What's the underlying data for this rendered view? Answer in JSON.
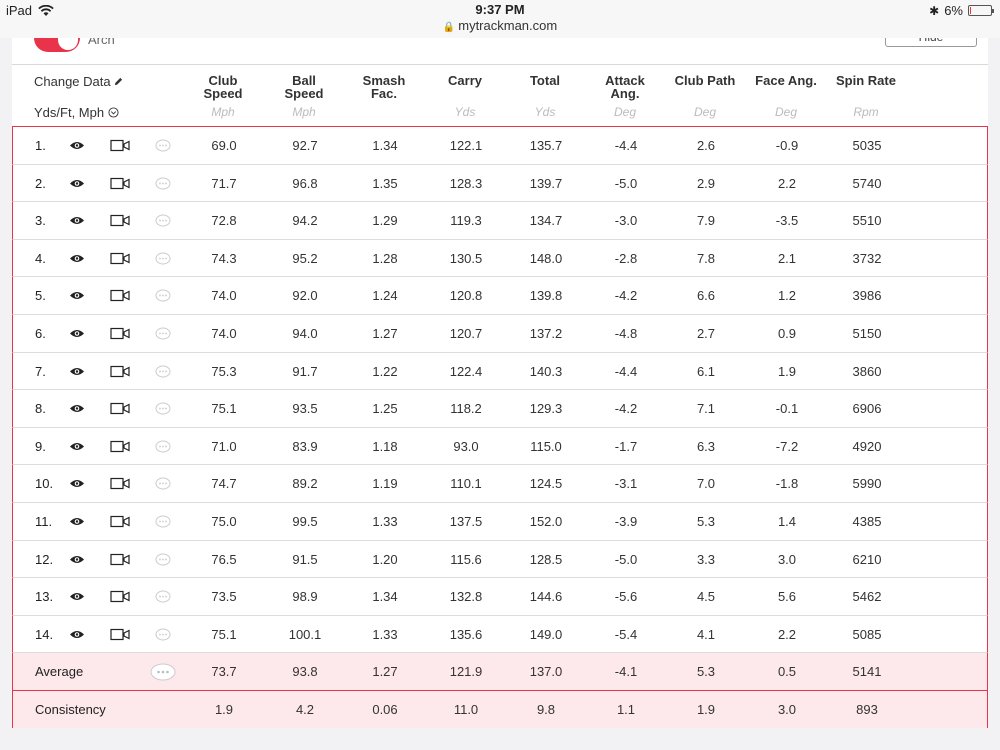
{
  "status_bar": {
    "device": "iPad",
    "time": "9:37 PM",
    "battery": "6%",
    "battery_level": 0.06
  },
  "url": "mytrackman.com",
  "top": {
    "toggle_label": "Arch",
    "hide_label": "Hide"
  },
  "header": {
    "change_data": "Change Data",
    "units": "Yds/Ft, Mph",
    "columns": [
      {
        "label": [
          "Club",
          "Speed"
        ],
        "unit": "Mph"
      },
      {
        "label": [
          "Ball",
          "Speed"
        ],
        "unit": "Mph"
      },
      {
        "label": [
          "Smash",
          "Fac."
        ],
        "unit": ""
      },
      {
        "label": [
          "Carry",
          ""
        ],
        "unit": "Yds"
      },
      {
        "label": [
          "Total",
          ""
        ],
        "unit": "Yds"
      },
      {
        "label": [
          "Attack",
          "Ang."
        ],
        "unit": "Deg"
      },
      {
        "label": [
          "Club Path",
          ""
        ],
        "unit": "Deg"
      },
      {
        "label": [
          "Face Ang.",
          ""
        ],
        "unit": "Deg"
      },
      {
        "label": [
          "Spin Rate",
          ""
        ],
        "unit": "Rpm"
      }
    ]
  },
  "rows": [
    {
      "num": "1.",
      "values": [
        "69.0",
        "92.7",
        "1.34",
        "122.1",
        "135.7",
        "-4.4",
        "2.6",
        "-0.9",
        "5035"
      ]
    },
    {
      "num": "2.",
      "values": [
        "71.7",
        "96.8",
        "1.35",
        "128.3",
        "139.7",
        "-5.0",
        "2.9",
        "2.2",
        "5740"
      ]
    },
    {
      "num": "3.",
      "values": [
        "72.8",
        "94.2",
        "1.29",
        "119.3",
        "134.7",
        "-3.0",
        "7.9",
        "-3.5",
        "5510"
      ]
    },
    {
      "num": "4.",
      "values": [
        "74.3",
        "95.2",
        "1.28",
        "130.5",
        "148.0",
        "-2.8",
        "7.8",
        "2.1",
        "3732"
      ]
    },
    {
      "num": "5.",
      "values": [
        "74.0",
        "92.0",
        "1.24",
        "120.8",
        "139.8",
        "-4.2",
        "6.6",
        "1.2",
        "3986"
      ]
    },
    {
      "num": "6.",
      "values": [
        "74.0",
        "94.0",
        "1.27",
        "120.7",
        "137.2",
        "-4.8",
        "2.7",
        "0.9",
        "5150"
      ]
    },
    {
      "num": "7.",
      "values": [
        "75.3",
        "91.7",
        "1.22",
        "122.4",
        "140.3",
        "-4.4",
        "6.1",
        "1.9",
        "3860"
      ]
    },
    {
      "num": "8.",
      "values": [
        "75.1",
        "93.5",
        "1.25",
        "118.2",
        "129.3",
        "-4.2",
        "7.1",
        "-0.1",
        "6906"
      ]
    },
    {
      "num": "9.",
      "values": [
        "71.0",
        "83.9",
        "1.18",
        "93.0",
        "115.0",
        "-1.7",
        "6.3",
        "-7.2",
        "4920"
      ]
    },
    {
      "num": "10.",
      "values": [
        "74.7",
        "89.2",
        "1.19",
        "110.1",
        "124.5",
        "-3.1",
        "7.0",
        "-1.8",
        "5990"
      ]
    },
    {
      "num": "11.",
      "values": [
        "75.0",
        "99.5",
        "1.33",
        "137.5",
        "152.0",
        "-3.9",
        "5.3",
        "1.4",
        "4385"
      ]
    },
    {
      "num": "12.",
      "values": [
        "76.5",
        "91.5",
        "1.20",
        "115.6",
        "128.5",
        "-5.0",
        "3.3",
        "3.0",
        "6210"
      ]
    },
    {
      "num": "13.",
      "values": [
        "73.5",
        "98.9",
        "1.34",
        "132.8",
        "144.6",
        "-5.6",
        "4.5",
        "5.6",
        "5462"
      ]
    },
    {
      "num": "14.",
      "values": [
        "75.1",
        "100.1",
        "1.33",
        "135.6",
        "149.0",
        "-5.4",
        "4.1",
        "2.2",
        "5085"
      ]
    }
  ],
  "summary": [
    {
      "label": "Average",
      "values": [
        "73.7",
        "93.8",
        "1.27",
        "121.9",
        "137.0",
        "-4.1",
        "5.3",
        "0.5",
        "5141"
      ]
    },
    {
      "label": "Consistency",
      "values": [
        "1.9",
        "4.2",
        "0.06",
        "11.0",
        "9.8",
        "1.1",
        "1.9",
        "3.0",
        "893"
      ]
    }
  ],
  "colors": {
    "accent": "#e8334a",
    "summary_bg": "#fde8ec"
  }
}
